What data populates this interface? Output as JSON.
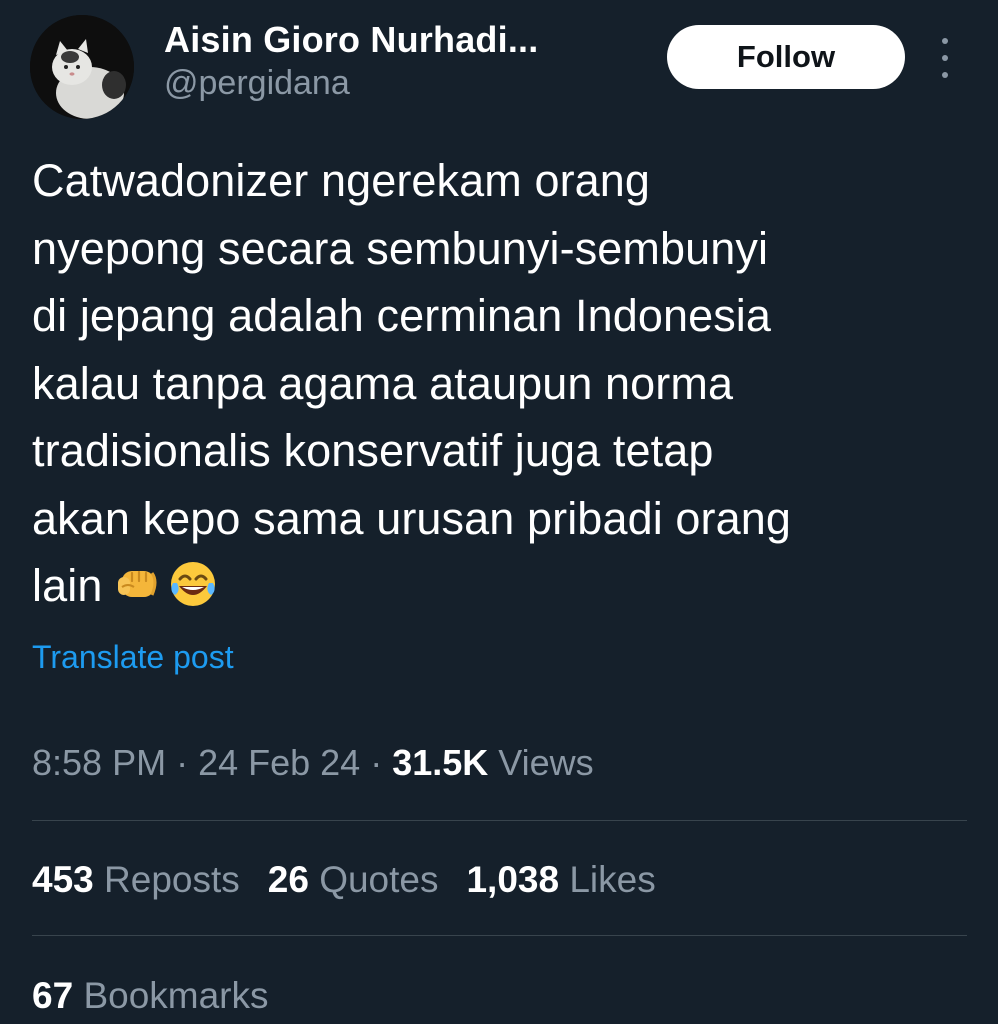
{
  "author": {
    "display_name": "Aisin Gioro Nurhadi...",
    "handle": "@pergidana"
  },
  "actions": {
    "follow_label": "Follow"
  },
  "tweet": {
    "text": "Catwadonizer ngerekam orang\nnyepong secara sembunyi-sembunyi\ndi jepang adalah cerminan Indonesia\nkalau tanpa agama ataupun norma\ntradisionalis konservatif juga tetap\nakan kepo sama urusan pribadi orang\nlain",
    "emojis": [
      "fist-icon",
      "tears-of-joy-icon"
    ],
    "translate_label": "Translate post"
  },
  "meta": {
    "time": "8:58 PM",
    "separator": " · ",
    "date": "24 Feb 24",
    "views_count": "31.5K",
    "views_label": "Views"
  },
  "stats": {
    "reposts_count": "453",
    "reposts_label": "Reposts",
    "quotes_count": "26",
    "quotes_label": "Quotes",
    "likes_count": "1,038",
    "likes_label": "Likes",
    "bookmarks_count": "67",
    "bookmarks_label": "Bookmarks"
  },
  "colors": {
    "background": "#15202b",
    "text_primary": "#ffffff",
    "text_secondary": "#8b98a5",
    "link": "#1d9bf0",
    "divider": "#38444d"
  }
}
